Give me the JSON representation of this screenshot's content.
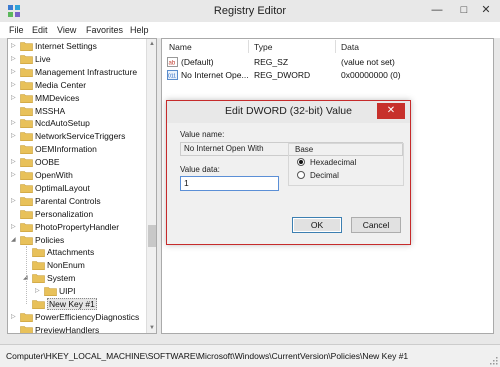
{
  "window": {
    "title": "Registry Editor",
    "controls": {
      "minimize": "—",
      "maximize": "□",
      "close": "✕"
    }
  },
  "menu": [
    "File",
    "Edit",
    "View",
    "Favorites",
    "Help"
  ],
  "tree": {
    "items": [
      {
        "label": "Internet Settings",
        "expander": "▷",
        "indent": 0
      },
      {
        "label": "Live",
        "expander": "▷",
        "indent": 0
      },
      {
        "label": "Management Infrastructure",
        "expander": "▷",
        "indent": 0
      },
      {
        "label": "Media Center",
        "expander": "▷",
        "indent": 0
      },
      {
        "label": "MMDevices",
        "expander": "▷",
        "indent": 0
      },
      {
        "label": "MSSHA",
        "expander": "",
        "indent": 0
      },
      {
        "label": "NcdAutoSetup",
        "expander": "▷",
        "indent": 0
      },
      {
        "label": "NetworkServiceTriggers",
        "expander": "▷",
        "indent": 0
      },
      {
        "label": "OEMInformation",
        "expander": "",
        "indent": 0
      },
      {
        "label": "OOBE",
        "expander": "▷",
        "indent": 0
      },
      {
        "label": "OpenWith",
        "expander": "▷",
        "indent": 0
      },
      {
        "label": "OptimalLayout",
        "expander": "",
        "indent": 0
      },
      {
        "label": "Parental Controls",
        "expander": "▷",
        "indent": 0
      },
      {
        "label": "Personalization",
        "expander": "",
        "indent": 0
      },
      {
        "label": "PhotoPropertyHandler",
        "expander": "▷",
        "indent": 0
      },
      {
        "label": "Policies",
        "expander": "◢",
        "indent": 0
      },
      {
        "label": "Attachments",
        "expander": "",
        "indent": 1
      },
      {
        "label": "NonEnum",
        "expander": "",
        "indent": 1
      },
      {
        "label": "System",
        "expander": "◢",
        "indent": 1
      },
      {
        "label": "UIPI",
        "expander": "▷",
        "indent": 2
      },
      {
        "label": "New Key #1",
        "expander": "",
        "indent": 1,
        "selected": true
      },
      {
        "label": "PowerEfficiencyDiagnostics",
        "expander": "▷",
        "indent": 0
      },
      {
        "label": "PreviewHandlers",
        "expander": "",
        "indent": 0
      }
    ],
    "scroll": {
      "up": "▲",
      "down": "▼"
    }
  },
  "values_pane": {
    "columns": [
      "Name",
      "Type",
      "Data"
    ],
    "rows": [
      {
        "name": "(Default)",
        "type": "REG_SZ",
        "data": "(value not set)",
        "icon": "string-value-icon"
      },
      {
        "name": "No Internet Ope...",
        "type": "REG_DWORD",
        "data": "0x00000000 (0)",
        "icon": "dword-value-icon"
      }
    ]
  },
  "status_bar": {
    "path": "Computer\\HKEY_LOCAL_MACHINE\\SOFTWARE\\Microsoft\\Windows\\CurrentVersion\\Policies\\New Key #1"
  },
  "dialog": {
    "title": "Edit DWORD (32-bit) Value",
    "close": "✕",
    "value_name_label": "Value name:",
    "value_name": "No Internet Open With",
    "value_data_label": "Value data:",
    "value_data": "1",
    "base_label": "Base",
    "base_options": [
      {
        "label": "Hexadecimal",
        "selected": true
      },
      {
        "label": "Decimal",
        "selected": false
      }
    ],
    "ok_label": "OK",
    "cancel_label": "Cancel"
  },
  "colors": {
    "accent": "#3c7fb1",
    "close_red": "#c7302b",
    "folder": "#e8c15a"
  }
}
